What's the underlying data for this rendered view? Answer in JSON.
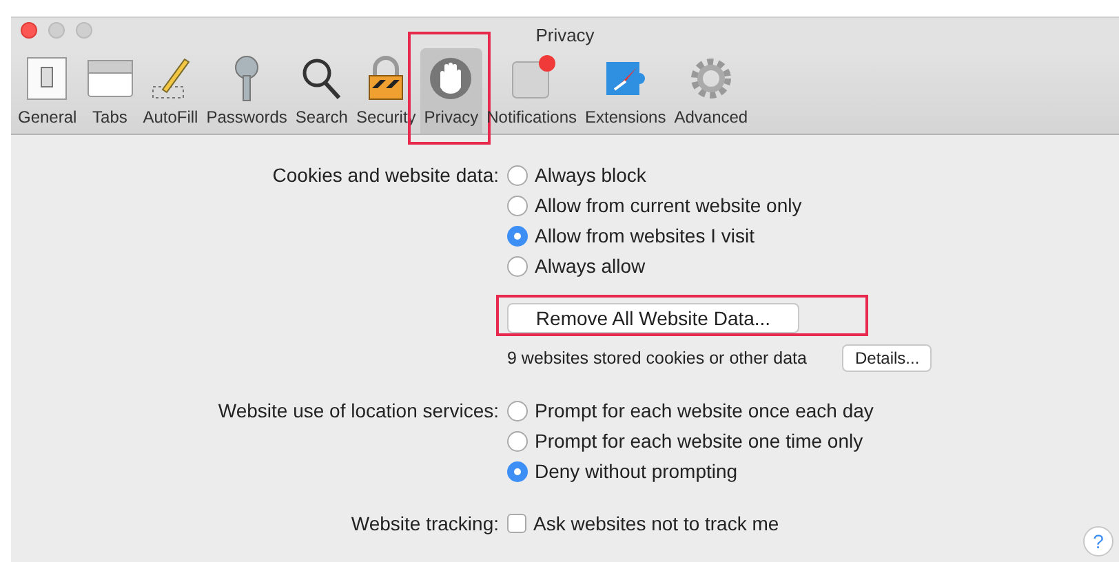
{
  "window": {
    "title": "Privacy"
  },
  "toolbar": [
    {
      "label": "General",
      "selected": false,
      "highlighted": false
    },
    {
      "label": "Tabs",
      "selected": false,
      "highlighted": false
    },
    {
      "label": "AutoFill",
      "selected": false,
      "highlighted": false
    },
    {
      "label": "Passwords",
      "selected": false,
      "highlighted": false
    },
    {
      "label": "Search",
      "selected": false,
      "highlighted": false
    },
    {
      "label": "Security",
      "selected": false,
      "highlighted": false
    },
    {
      "label": "Privacy",
      "selected": true,
      "highlighted": true
    },
    {
      "label": "Notifications",
      "selected": false,
      "highlighted": false,
      "badge": true
    },
    {
      "label": "Extensions",
      "selected": false,
      "highlighted": false
    },
    {
      "label": "Advanced",
      "selected": false,
      "highlighted": false
    }
  ],
  "cookies": {
    "label": "Cookies and website data:",
    "options": [
      {
        "label": "Always block",
        "selected": false
      },
      {
        "label": "Allow from current website only",
        "selected": false
      },
      {
        "label": "Allow from websites I visit",
        "selected": true
      },
      {
        "label": "Always allow",
        "selected": false
      }
    ],
    "remove_button": {
      "label": "Remove All Website Data...",
      "highlighted": true
    },
    "note": "9 websites stored cookies or other data",
    "details_button": "Details..."
  },
  "location": {
    "label": "Website use of location services:",
    "options": [
      {
        "label": "Prompt for each website once each day",
        "selected": false
      },
      {
        "label": "Prompt for each website one time only",
        "selected": false
      },
      {
        "label": "Deny without prompting",
        "selected": true
      }
    ]
  },
  "tracking": {
    "label": "Website tracking:",
    "option": {
      "label": "Ask websites not to track me",
      "checked": false
    }
  },
  "help_button": "?"
}
